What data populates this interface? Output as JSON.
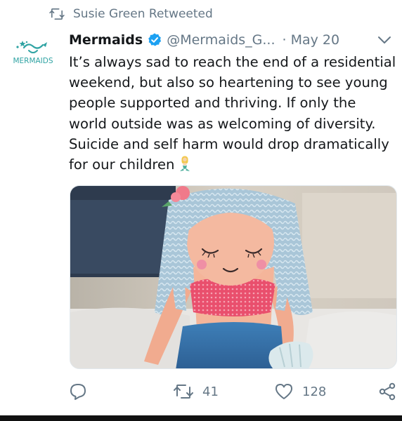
{
  "retweet": {
    "icon": "retweet-icon",
    "text": "Susie Green Retweeted"
  },
  "author": {
    "avatar_text": "MERMAIDS",
    "name": "Mermaids",
    "verified_icon": "verified-badge-icon",
    "handle": "@Mermaids_G...",
    "separator": "·",
    "date": "May 20",
    "menu_icon": "chevron-down-icon"
  },
  "tweet": {
    "lines": [
      "It’s always sad to reach the end of a residential",
      "weekend, but also so heartening to see young",
      "people supported and thriving. If only the",
      "world outside was as welcoming of diversity.",
      "Suicide and self harm would drop dramatically",
      "for our children"
    ],
    "emoji": "mermaid-emoji-icon"
  },
  "media": {
    "icon": "photo-of-mermaid-doll"
  },
  "actions": {
    "reply": {
      "icon": "reply-icon",
      "count": ""
    },
    "retweet": {
      "icon": "retweet-icon",
      "count": "41"
    },
    "like": {
      "icon": "heart-icon",
      "count": "128"
    },
    "share": {
      "icon": "share-icon",
      "count": ""
    }
  },
  "colors": {
    "text": "#14171a",
    "secondary": "#657786",
    "verified": "#1da1f2",
    "brand_teal": "#2fa3a3"
  }
}
